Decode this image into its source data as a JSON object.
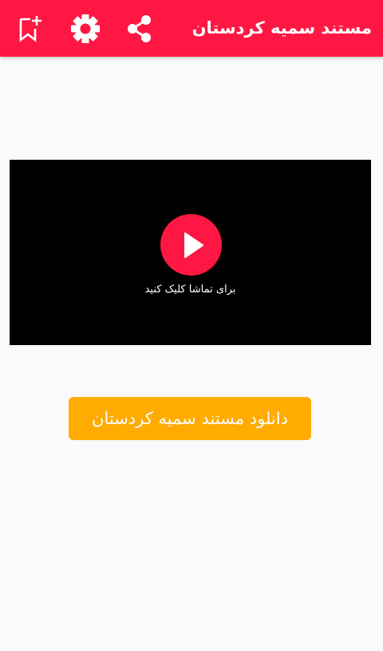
{
  "appbar": {
    "title": "مستند سمیه کردستان",
    "color": "#ff1744",
    "actions": [
      {
        "icon": "bookmark-add-icon"
      },
      {
        "icon": "gear-icon"
      },
      {
        "icon": "share-icon"
      }
    ]
  },
  "video": {
    "caption": "برای تماشا کلیک کنید",
    "play_icon": "play-icon",
    "background": "#000000"
  },
  "download": {
    "label": "دانلود مستند سمیه کردستان",
    "color": "#ffab00"
  }
}
